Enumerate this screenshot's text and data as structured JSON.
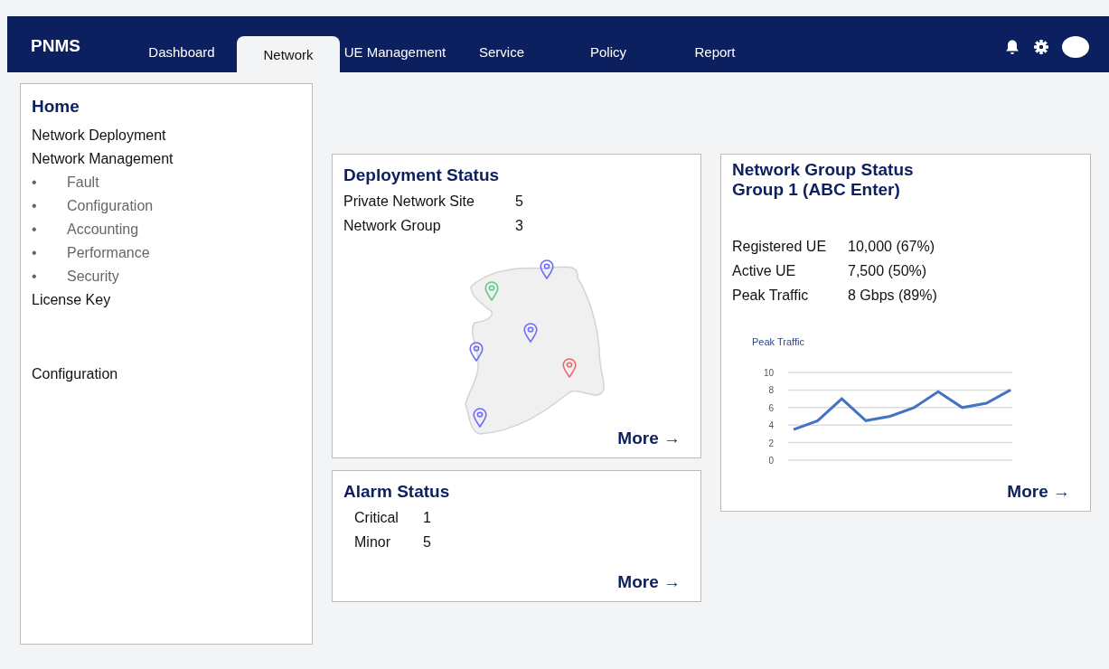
{
  "header": {
    "logo": "PNMS",
    "tabs": [
      {
        "label": "Dashboard",
        "selected": false
      },
      {
        "label": "Network",
        "selected": true
      },
      {
        "label": "UE Management",
        "selected": false
      },
      {
        "label": "Service",
        "selected": false
      },
      {
        "label": "Policy",
        "selected": false
      },
      {
        "label": "Report",
        "selected": false
      }
    ]
  },
  "sidebar": {
    "title": "Home",
    "sections": [
      {
        "items": [
          {
            "label": "Network Deployment"
          },
          {
            "label": "Network Management",
            "children": [
              {
                "marker": "•",
                "label": "Fault"
              },
              {
                "marker": "•",
                "label": "Configuration"
              },
              {
                "marker": "•",
                "label": "Accounting"
              },
              {
                "marker": "•",
                "label": "Performance"
              },
              {
                "marker": "•",
                "label": "Security"
              }
            ]
          },
          {
            "label": "License Key"
          }
        ]
      },
      {
        "items": [
          {
            "label": "Configuration"
          }
        ]
      }
    ]
  },
  "deployment_status": {
    "title": "Deployment Status",
    "stats": [
      {
        "label": "Private Network Site",
        "value": "5"
      },
      {
        "label": "Network Group",
        "value": "3"
      }
    ],
    "map_pins": [
      {
        "color": "#6b6bf5"
      },
      {
        "color": "#5cc98a"
      },
      {
        "color": "#6b6bf5"
      },
      {
        "color": "#6b6bf5"
      },
      {
        "color": "#f06767"
      },
      {
        "color": "#6b6bf5"
      }
    ],
    "more": "More →"
  },
  "alarm_status": {
    "title": "Alarm Status",
    "stats": [
      {
        "label": "Critical",
        "value": "1"
      },
      {
        "label": "Minor",
        "value": "5"
      }
    ],
    "more": "More →"
  },
  "network_group_status": {
    "title": "Network Group Status",
    "subtitle": "Group 1 (ABC Enter)",
    "stats": [
      {
        "label": "Registered UE",
        "value": "10,000 (67%)"
      },
      {
        "label": "Active UE",
        "value": "7,500 (50%)"
      },
      {
        "label": "Peak Traffic",
        "value": "8 Gbps (89%)"
      }
    ],
    "chart_data": {
      "type": "line",
      "title": "Peak Traffic",
      "grid": true,
      "series": [
        {
          "color": "#4472c4",
          "values": [
            3.5,
            4.5,
            7,
            4.5,
            5,
            6,
            7.8,
            6,
            6.5,
            8
          ]
        }
      ],
      "ylim": [
        0,
        10
      ],
      "yticks": [
        0,
        2,
        4,
        6,
        8,
        10
      ]
    },
    "more": "More →"
  }
}
